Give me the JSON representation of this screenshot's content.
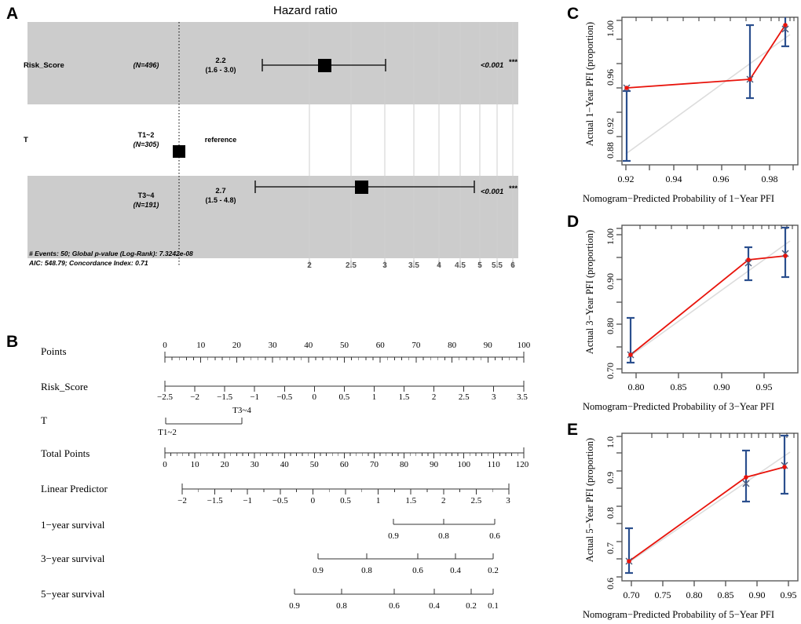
{
  "figure": {
    "panels": [
      "A",
      "B",
      "C",
      "D",
      "E"
    ]
  },
  "panelA": {
    "letter": "A",
    "title": "Hazard ratio",
    "footnote_line1": "# Events: 50; Global p-value (Log-Rank): 7.3242e-08",
    "footnote_line2": "AIC: 548.79; Concordance Index: 0.71",
    "rows": [
      {
        "variable": "Risk_Score",
        "level": "",
        "n": "(N=496)",
        "estimate": "2.2",
        "ci": "(1.6 - 3.0)",
        "pvalue": "<0.001",
        "stars": "***",
        "shaded": true,
        "reference": false,
        "hr": 2.2,
        "lo": 1.6,
        "hi": 3.0
      },
      {
        "variable": "T",
        "level": "T1~2",
        "n": "(N=305)",
        "estimate": "reference",
        "ci": "",
        "pvalue": "",
        "stars": "",
        "shaded": false,
        "reference": true,
        "hr": 1.0,
        "lo": 1.0,
        "hi": 1.0
      },
      {
        "variable": "",
        "level": "T3~4",
        "n": "(N=191)",
        "estimate": "2.7",
        "ci": "(1.5 - 4.8)",
        "pvalue": "<0.001",
        "stars": "***",
        "shaded": true,
        "reference": false,
        "hr": 2.7,
        "lo": 1.5,
        "hi": 4.8
      }
    ],
    "axis_ticks": [
      "2",
      "2.5",
      "3",
      "3.5",
      "4",
      "4.5",
      "5",
      "5.5",
      "6"
    ],
    "axis_tick_values": [
      2,
      2.5,
      3,
      3.5,
      4,
      4.5,
      5,
      5.5,
      6
    ],
    "axis_scale": "log",
    "band_color": "#cccccc"
  },
  "panelB": {
    "letter": "B",
    "axes": [
      {
        "name": "Points",
        "ticks": [
          "0",
          "10",
          "20",
          "30",
          "40",
          "50",
          "60",
          "70",
          "80",
          "90",
          "100"
        ],
        "labels_above": true,
        "minor_per_major": 5
      },
      {
        "name": "Risk_Score",
        "ticks": [
          "−2.5",
          "−2",
          "−1.5",
          "−1",
          "−0.5",
          "0",
          "0.5",
          "1",
          "1.5",
          "2",
          "2.5",
          "3",
          "3.5"
        ],
        "labels_above": false,
        "minor_per_major": 0
      },
      {
        "name": "T",
        "categories": [
          "T1~2",
          "T3~4"
        ],
        "type": "categorical"
      },
      {
        "name": "Total Points",
        "ticks": [
          "0",
          "10",
          "20",
          "30",
          "40",
          "50",
          "60",
          "70",
          "80",
          "90",
          "100",
          "110",
          "120"
        ],
        "labels_above": false,
        "minor_per_major": 5
      },
      {
        "name": "Linear Predictor",
        "ticks": [
          "−2",
          "−1.5",
          "−1",
          "−0.5",
          "0",
          "0.5",
          "1",
          "1.5",
          "2",
          "2.5",
          "3"
        ],
        "labels_above": false,
        "minor_per_major": 2
      },
      {
        "name": "1−year survival",
        "ticks": [
          "0.9",
          "0.8",
          "0.6"
        ],
        "labels_above": false,
        "type": "survival"
      },
      {
        "name": "3−year survival",
        "ticks": [
          "0.9",
          "0.8",
          "0.6",
          "0.4",
          "0.2"
        ],
        "labels_above": false,
        "type": "survival"
      },
      {
        "name": "5−year survival",
        "ticks": [
          "0.9",
          "0.8",
          "0.6",
          "0.4",
          "0.2",
          "0.1"
        ],
        "labels_above": false,
        "type": "survival"
      }
    ]
  },
  "panelC": {
    "letter": "C",
    "ylabel": "Actual 1−Year PFI (proportion)",
    "xlabel": "Nomogram−Predicted Probability of 1−Year PFI",
    "xticks": [
      "0.92",
      "0.94",
      "0.96",
      "0.98"
    ],
    "yticks": [
      "0.88",
      "0.92",
      "0.96",
      "1.00"
    ]
  },
  "panelD": {
    "letter": "D",
    "ylabel": "Actual 3−Year PFI (proportion)",
    "xlabel": "Nomogram−Predicted Probability of 3−Year PFI",
    "xticks": [
      "0.80",
      "0.85",
      "0.90",
      "0.95"
    ],
    "yticks": [
      "0.70",
      "0.80",
      "0.90",
      "1.00"
    ]
  },
  "panelE": {
    "letter": "E",
    "ylabel": "Actual 5−Year PFI (proportion)",
    "xlabel": "Nomogram−Predicted Probability of 5−Year PFI",
    "xticks": [
      "0.70",
      "0.75",
      "0.80",
      "0.85",
      "0.90",
      "0.95"
    ],
    "yticks": [
      "0.6",
      "0.7",
      "0.8",
      "0.9",
      "1.0"
    ]
  },
  "colors": {
    "band": "#cccccc",
    "grid": "#cfcfcf",
    "calibration_line": "#e8140c",
    "error_bar": "#2b4f8e",
    "ideal_line": "#dcdcdc",
    "axis": "#555555",
    "text": "#000000"
  },
  "chart_data": [
    {
      "type": "bar",
      "name": "forest-plot-hazard-ratio",
      "title": "Hazard ratio",
      "xlabel": "",
      "ylabel": "",
      "axis_scale": "log",
      "xlim": [
        1.0,
        6.0
      ],
      "xticks": [
        2,
        2.5,
        3,
        3.5,
        4,
        4.5,
        5,
        5.5,
        6
      ],
      "categories": [
        "Risk_Score (N=496)",
        "T: T1~2 (N=305)",
        "T: T3~4 (N=191)"
      ],
      "series": [
        {
          "name": "hazard ratio",
          "values": [
            2.2,
            1.0,
            2.7
          ]
        },
        {
          "name": "CI lower",
          "values": [
            1.6,
            null,
            1.5
          ]
        },
        {
          "name": "CI upper",
          "values": [
            3.0,
            null,
            4.8
          ]
        }
      ],
      "pvalues": [
        "<0.001",
        "reference",
        "<0.001"
      ],
      "annotations": [
        "# Events: 50; Global p-value (Log-Rank): 7.3242e-08",
        "AIC: 548.79; Concordance Index: 0.71"
      ]
    },
    {
      "type": "table",
      "name": "nomogram",
      "title": "",
      "rows": [
        {
          "axis": "Points",
          "range": [
            0,
            100
          ],
          "ticks": [
            0,
            10,
            20,
            30,
            40,
            50,
            60,
            70,
            80,
            90,
            100
          ]
        },
        {
          "axis": "Risk_Score",
          "range": [
            -2.5,
            3.5
          ],
          "ticks": [
            -2.5,
            -2,
            -1.5,
            -1,
            -0.5,
            0,
            0.5,
            1,
            1.5,
            2,
            2.5,
            3,
            3.5
          ]
        },
        {
          "axis": "T",
          "categories": [
            "T1~2",
            "T3~4"
          ],
          "points": [
            0,
            21
          ]
        },
        {
          "axis": "Total Points",
          "range": [
            0,
            120
          ],
          "ticks": [
            0,
            10,
            20,
            30,
            40,
            50,
            60,
            70,
            80,
            90,
            100,
            110,
            120
          ]
        },
        {
          "axis": "Linear Predictor",
          "range": [
            -2,
            3
          ],
          "ticks": [
            -2,
            -1.5,
            -1,
            -0.5,
            0,
            0.5,
            1,
            1.5,
            2,
            2.5,
            3
          ]
        },
        {
          "axis": "1-year survival",
          "ticks": [
            0.9,
            0.8,
            0.6
          ]
        },
        {
          "axis": "3-year survival",
          "ticks": [
            0.9,
            0.8,
            0.6,
            0.4,
            0.2
          ]
        },
        {
          "axis": "5-year survival",
          "ticks": [
            0.9,
            0.8,
            0.6,
            0.4,
            0.2,
            0.1
          ]
        }
      ]
    },
    {
      "type": "line",
      "name": "calibration-1-year",
      "title": "C",
      "xlabel": "Nomogram-Predicted Probability of 1-Year PFI",
      "ylabel": "Actual 1-Year PFI (proportion)",
      "xlim": [
        0.9095,
        0.9905
      ],
      "ylim": [
        0.868,
        1.005
      ],
      "xticks": [
        0.92,
        0.94,
        0.96,
        0.98
      ],
      "yticks": [
        0.88,
        0.92,
        0.96,
        1.0
      ],
      "x": [
        0.9222,
        0.9732,
        0.9878
      ],
      "y": [
        0.9235,
        0.9685,
        0.993
      ],
      "y_ideal": [
        0.9222,
        0.9732,
        0.9878
      ],
      "ci_lower": [
        0.8825,
        0.9405,
        0.98
      ],
      "ci_upper": [
        0.961,
        0.9965,
        1.0
      ],
      "grid": false,
      "legend": "none"
    },
    {
      "type": "line",
      "name": "calibration-3-year",
      "title": "D",
      "xlabel": "Nomogram-Predicted Probability of 3-Year PFI",
      "ylabel": "Actual 3-Year PFI (proportion)",
      "xlim": [
        0.762,
        0.968
      ],
      "ylim": [
        0.675,
        1.005
      ],
      "xticks": [
        0.8,
        0.85,
        0.9,
        0.95
      ],
      "yticks": [
        0.7,
        0.8,
        0.9,
        1.0
      ],
      "x": [
        0.7705,
        0.9155,
        0.959
      ],
      "y": [
        0.765,
        0.9375,
        0.947
      ],
      "y_ideal": [
        0.7705,
        0.929,
        0.955
      ],
      "ci_lower": [
        0.693,
        0.8955,
        0.9055
      ],
      "ci_upper": [
        0.833,
        0.969,
        0.988
      ],
      "grid": false,
      "legend": "none"
    },
    {
      "type": "line",
      "name": "calibration-5-year",
      "title": "E",
      "xlabel": "Nomogram-Predicted Probability of 5-Year PFI",
      "ylabel": "Actual 5-Year PFI (proportion)",
      "xlim": [
        0.676,
        0.956
      ],
      "ylim": [
        0.588,
        1.005
      ],
      "xticks": [
        0.7,
        0.75,
        0.8,
        0.85,
        0.9,
        0.95
      ],
      "yticks": [
        0.6,
        0.7,
        0.8,
        0.9,
        1.0
      ],
      "x": [
        0.6935,
        0.8795,
        0.94
      ],
      "y": [
        0.7045,
        0.894,
        0.924
      ],
      "y_ideal": [
        0.696,
        0.8855,
        0.932
      ],
      "ci_lower": [
        0.6085,
        0.824,
        0.8665
      ],
      "ci_upper": [
        0.812,
        0.967,
        0.988
      ],
      "grid": false,
      "legend": "none"
    }
  ]
}
